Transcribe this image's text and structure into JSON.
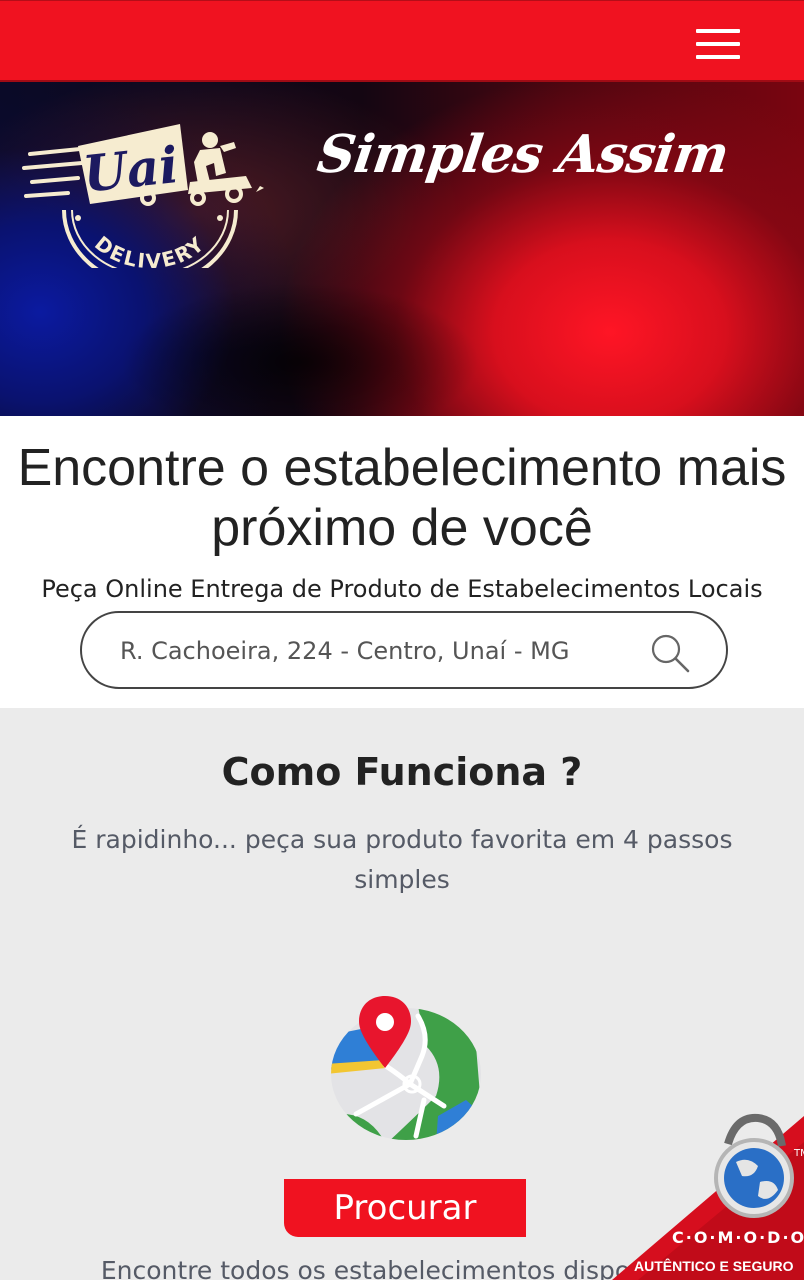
{
  "header": {
    "menu_icon": "hamburger-icon"
  },
  "hero": {
    "logo_word": "Uai",
    "logo_sub": "DELIVERY",
    "tagline": "Simples Assim",
    "colors": {
      "red": "#f01220",
      "blue": "#0b1aa0",
      "cream": "#f6ecd0"
    }
  },
  "main": {
    "headline": "Encontre o estabelecimento mais próximo de você",
    "subheadline": "Peça Online Entrega de Produto de Estabelecimentos Locais",
    "search": {
      "value": "R. Cachoeira, 224 - Centro, Unaí - MG",
      "icon": "search-icon"
    }
  },
  "how_it_works": {
    "title": "Como Funciona ?",
    "description": "É rapidinho... peça sua produto favorita em 4 passos simples",
    "step_icon": "map-pin-icon",
    "step_button": "Procurar",
    "step_description": "Encontre todos os estabelecimentos disponíveis"
  },
  "badge": {
    "brand": "C·O·M·O·D·O",
    "text": "AUTÊNTICO E SEGURO",
    "tm": "TM"
  }
}
